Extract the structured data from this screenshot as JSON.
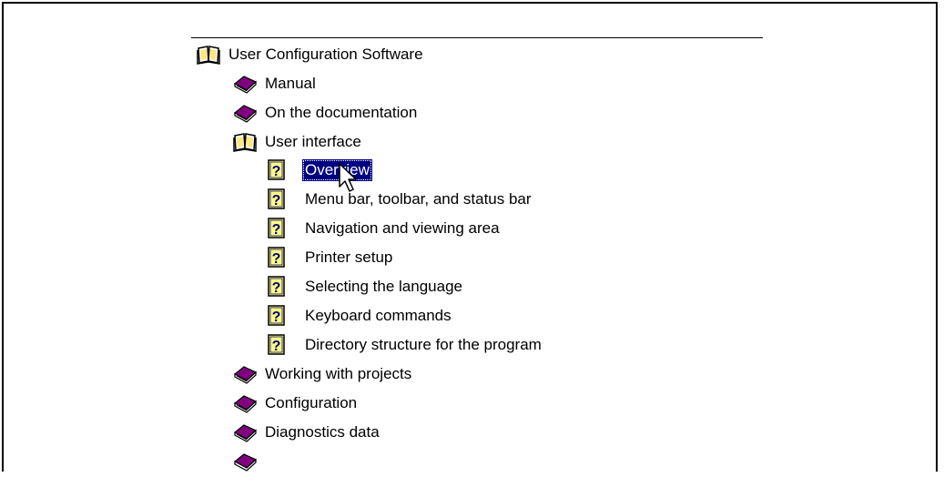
{
  "tree": {
    "root": {
      "label": "User Configuration Software",
      "icon": "open-book-icon"
    },
    "items": [
      {
        "label": "Manual",
        "icon": "closed-book-icon",
        "kind": "book"
      },
      {
        "label": "On the documentation",
        "icon": "closed-book-icon",
        "kind": "book"
      },
      {
        "label": "User interface",
        "icon": "open-book-icon",
        "kind": "book-open",
        "children": [
          {
            "label": "Overview",
            "icon": "help-topic-icon",
            "selected": true
          },
          {
            "label": "Menu bar, toolbar, and status bar",
            "icon": "help-topic-icon"
          },
          {
            "label": "Navigation and viewing area",
            "icon": "help-topic-icon"
          },
          {
            "label": "Printer setup",
            "icon": "help-topic-icon"
          },
          {
            "label": "Selecting the language",
            "icon": "help-topic-icon"
          },
          {
            "label": "Keyboard commands",
            "icon": "help-topic-icon"
          },
          {
            "label": "Directory structure for the program",
            "icon": "help-topic-icon"
          }
        ]
      },
      {
        "label": "Working with projects",
        "icon": "closed-book-icon",
        "kind": "book"
      },
      {
        "label": "Configuration",
        "icon": "closed-book-icon",
        "kind": "book"
      },
      {
        "label": "Diagnostics data",
        "icon": "closed-book-icon",
        "kind": "book"
      },
      {
        "label": "",
        "icon": "closed-book-icon",
        "kind": "book"
      }
    ]
  },
  "colors": {
    "selection": "#000080",
    "book": "#800080",
    "topic_bg": "#ffff80"
  }
}
